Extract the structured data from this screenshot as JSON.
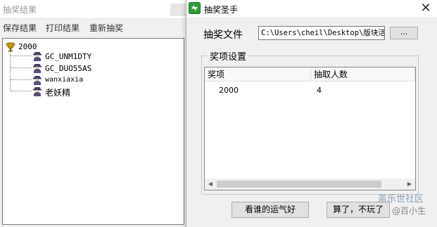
{
  "results_window": {
    "title": "抽奖结果",
    "menu": [
      "保存结果",
      "打印结果",
      "重新抽奖"
    ],
    "tree": {
      "root": "2000",
      "children": [
        "GC_UNM1DTY",
        "GC_DUO55AS",
        "wanxiaxia",
        "老妖精"
      ]
    }
  },
  "dialog": {
    "title": "抽奖圣手",
    "close_glyph": "✕",
    "file_label": "抽奖文件",
    "file_path": "C:\\Users\\cheil\\Desktop\\版块活",
    "browse_label": "...",
    "prize_group_label": "奖项设置",
    "columns": [
      "奖项",
      "抽取人数"
    ],
    "rows": [
      {
        "prize": "2000",
        "count": "4"
      }
    ],
    "lucky_button": "看谁的运气好",
    "quit_button": "算了，不玩了"
  },
  "watermark": {
    "site": "盖乐世社区",
    "author": "@百小生"
  },
  "icons": {
    "root": "trophy-icon",
    "person": "spy-person-icon",
    "app": "app-icon",
    "close": "close-icon"
  },
  "colors": {
    "app_icon": "#2e9d3a",
    "watermark": "#8aa0b8"
  }
}
